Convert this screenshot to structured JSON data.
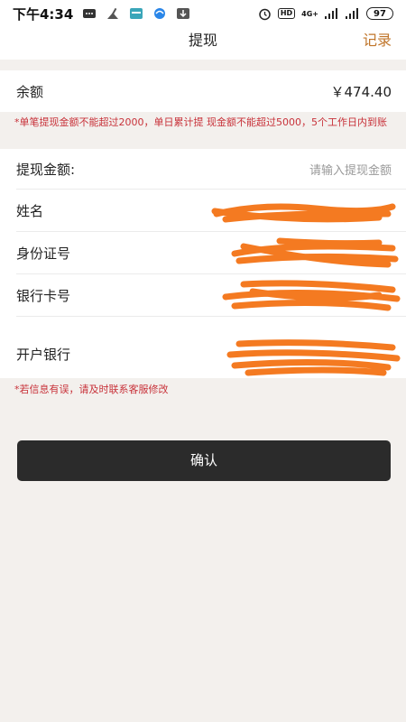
{
  "status_bar": {
    "time": "下午4:34",
    "network": "4G+",
    "hd": "HD",
    "battery": "97"
  },
  "nav": {
    "title": "提现",
    "action": "记录"
  },
  "balance": {
    "label": "余额",
    "value": "￥474.40"
  },
  "notice_top": "*单笔提现金额不能超过2000，单日累计提 现金额不能超过5000，5个工作日内到账",
  "form": {
    "amount_label": "提现金额:",
    "amount_placeholder": "请输入提现金额",
    "name_label": "姓名",
    "id_label": "身份证号",
    "card_label": "银行卡号",
    "bank_label": "开户银行"
  },
  "notice_bottom": "*若信息有误，请及时联系客服修改",
  "confirm_label": "确认",
  "colors": {
    "accent": "#c0752a",
    "warning": "#c8323a",
    "button": "#2b2b2b",
    "redaction": "#f47a21"
  }
}
